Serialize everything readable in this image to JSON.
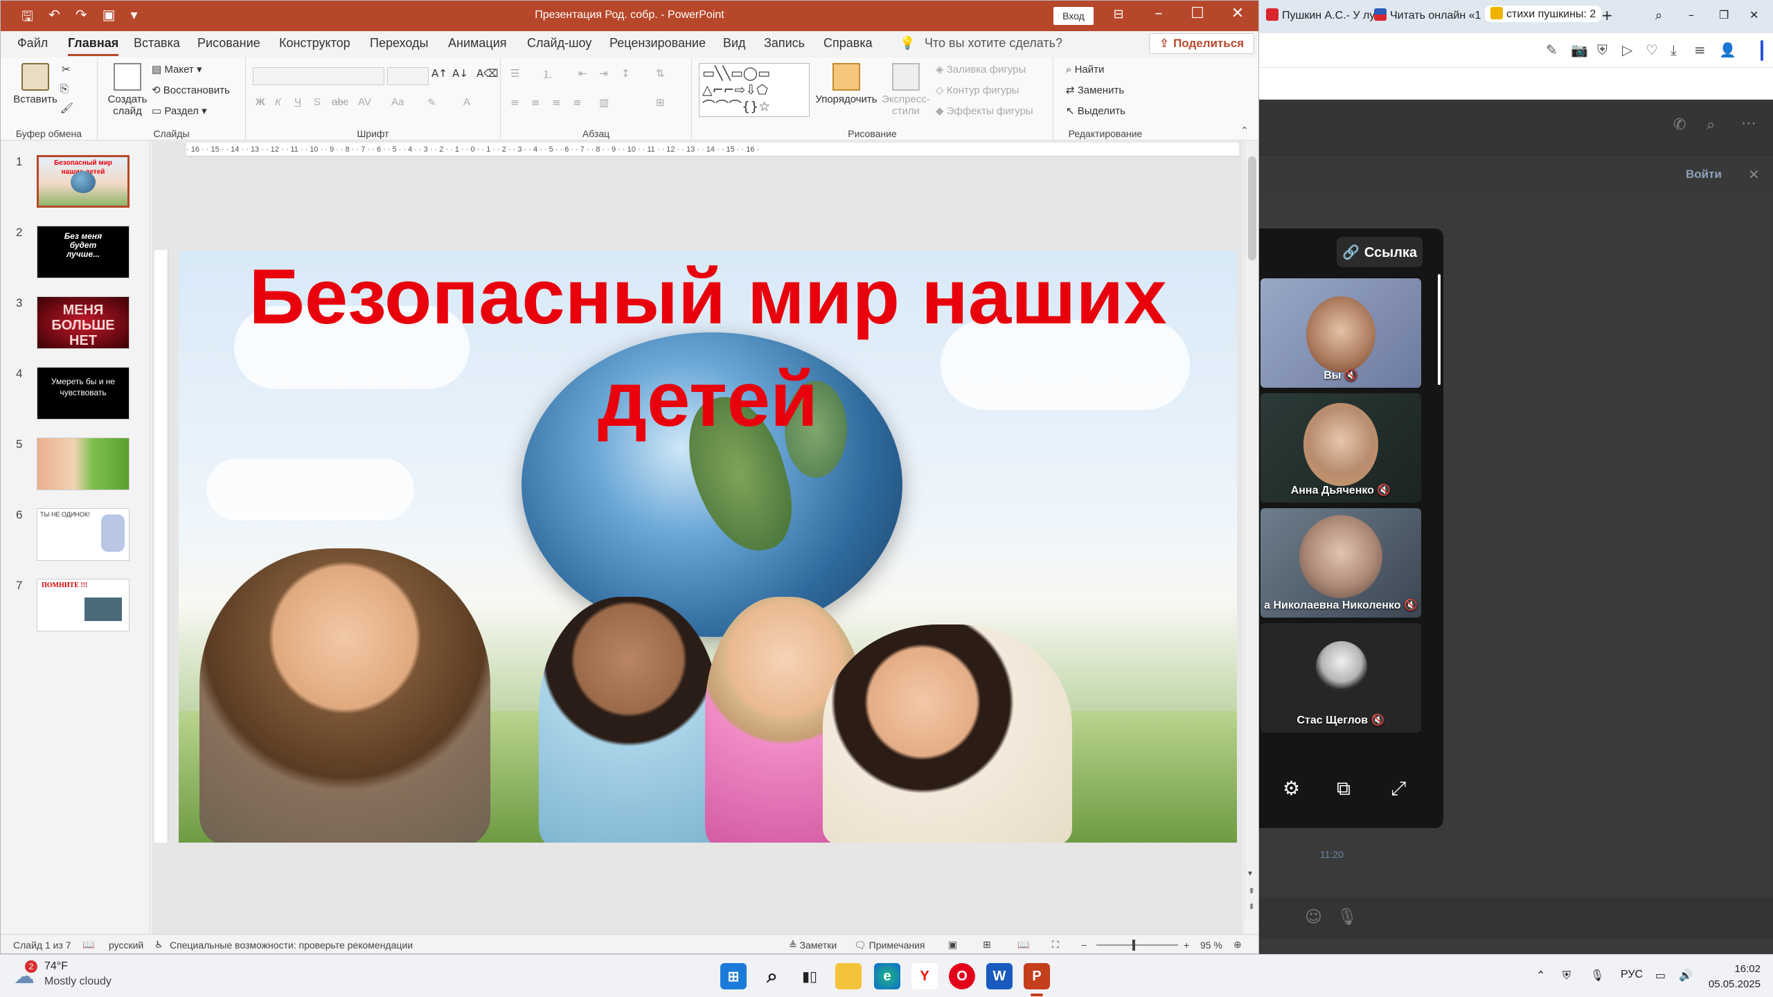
{
  "window": {
    "title": "Презентация Род. собр.  -  PowerPoint",
    "signin_label": "Вход"
  },
  "tabs": [
    "Файл",
    "Главная",
    "Вставка",
    "Рисование",
    "Конструктор",
    "Переходы",
    "Анимация",
    "Слайд-шоу",
    "Рецензирование",
    "Вид",
    "Запись",
    "Справка"
  ],
  "tellme": "Что вы хотите сделать?",
  "share_label": "Поделиться",
  "ribbon": {
    "clipboard": {
      "paste": "Вставить",
      "label": "Буфер обмена"
    },
    "slides": {
      "new_slide": "Создать слайд",
      "layout": "Макет",
      "reset": "Восстановить",
      "section": "Раздел",
      "label": "Слайды"
    },
    "font": {
      "label": "Шрифт"
    },
    "paragraph": {
      "label": "Абзац"
    },
    "drawing": {
      "arrange": "Упорядочить",
      "quick_styles": "Экспресс-стили",
      "fill": "Заливка фигуры",
      "outline": "Контур фигуры",
      "effects": "Эффекты фигуры",
      "label": "Рисование"
    },
    "editing": {
      "find": "Найти",
      "replace": "Заменить",
      "select": "Выделить",
      "label": "Редактирование"
    }
  },
  "thumbnails": [
    {
      "num": "1",
      "text": "Безопасный мир наших детей"
    },
    {
      "num": "2",
      "text": "Без меня будет лучше..."
    },
    {
      "num": "3",
      "text": "МЕНЯ БОЛЬШЕ НЕТ"
    },
    {
      "num": "4",
      "text": "Умереть бы и не чувствовать"
    },
    {
      "num": "5",
      "text": ""
    },
    {
      "num": "6",
      "text": "ТЫ НЕ ОДИНОК!"
    },
    {
      "num": "7",
      "text": "ПОМНИТЕ !!!"
    }
  ],
  "slide": {
    "title_line1": "Безопасный мир наших",
    "title_line2": "детей"
  },
  "status": {
    "slide_of": "Слайд 1 из 7",
    "language": "русский",
    "accessibility": "Специальные возможности: проверьте рекомендации",
    "notes": "Заметки",
    "comments": "Примечания",
    "zoom": "95 %"
  },
  "browser": {
    "tabs": [
      "Пушкин А.С.- У лу",
      "Читать онлайн «1",
      "стихи пушкины: 2"
    ],
    "join_label": "Войти",
    "link_label": "Ссылка",
    "participants": [
      "Вы",
      "Анна Дьяченко",
      "а Николаевна Николенко",
      "Стас Щеглов"
    ],
    "msg_time": "11:20"
  },
  "taskbar": {
    "weather_temp": "74°F",
    "weather_cond": "Mostly cloudy",
    "weather_badge": "2",
    "lang": "РУС",
    "time": "16:02",
    "date": "05.05.2025"
  }
}
